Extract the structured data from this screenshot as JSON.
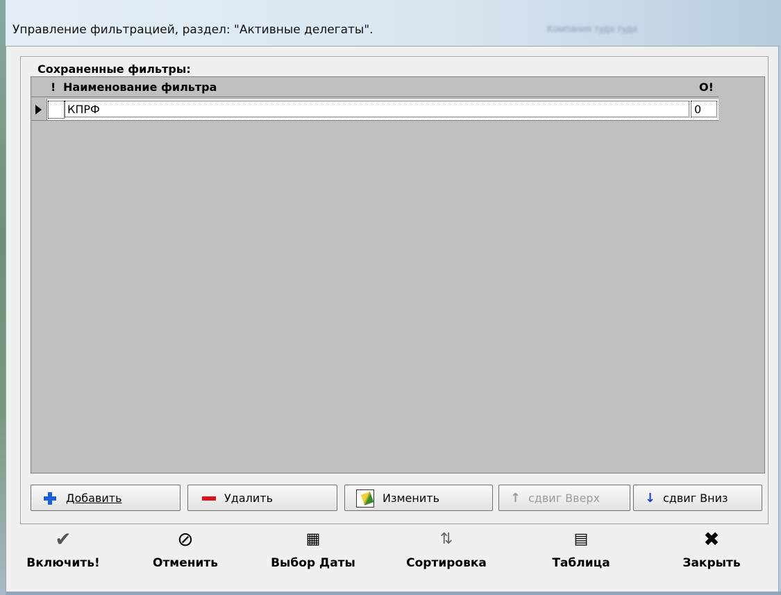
{
  "window": {
    "title": "Управление фильтрацией, раздел: \"Активные делегаты\".",
    "background_title": "Компания туда туда"
  },
  "saved_filters": {
    "group_label": "Сохраненные фильтры:",
    "columns": [
      "!",
      "Наименование фильтра",
      "О!"
    ],
    "rows": [
      {
        "flag": "",
        "name": "КПРФ",
        "o": "0"
      }
    ]
  },
  "grid_buttons": {
    "add": "Добавить",
    "delete": "Удалить",
    "edit": "Изменить",
    "move_up": "сдвиг Вверх",
    "move_down": "сдвиг Вниз"
  },
  "toolbar": {
    "enable": "Включить!",
    "cancel": "Отменить",
    "date": "Выбор Даты",
    "sort": "Сортировка",
    "table": "Таблица",
    "close": "Закрыть"
  },
  "colors": {
    "grid_background": "#c0c0c0",
    "plus_icon": "#1a5fe0",
    "minus_icon": "#e0101a"
  }
}
